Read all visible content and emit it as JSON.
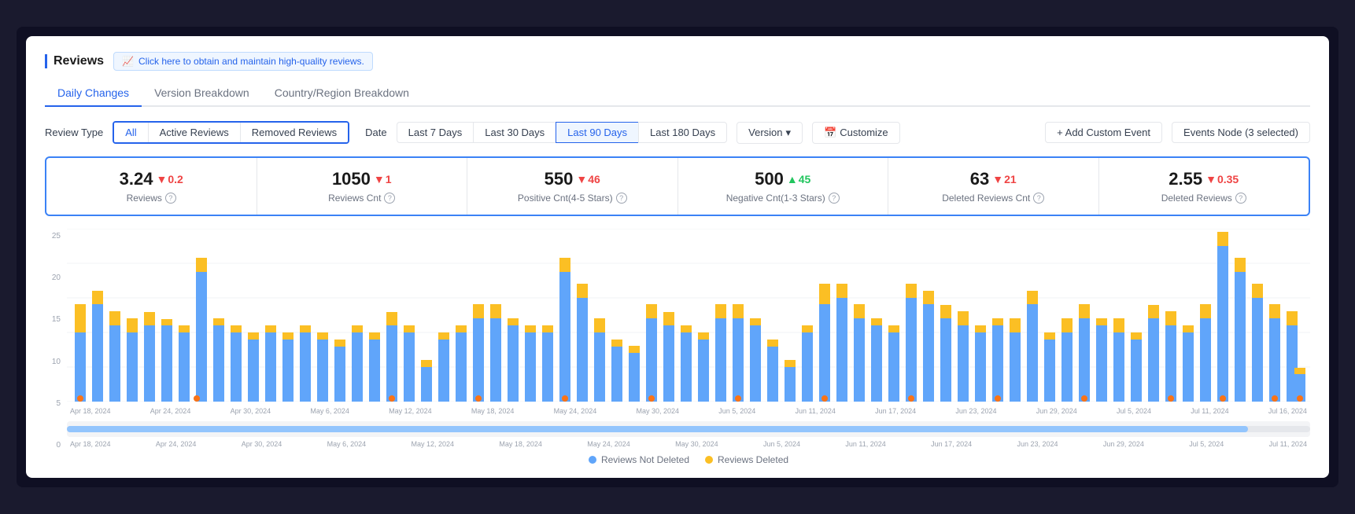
{
  "header": {
    "title": "Reviews",
    "quality_link_text": "Click here to obtain and maintain high-quality reviews.",
    "quality_link_icon": "📈"
  },
  "tabs": [
    {
      "id": "daily-changes",
      "label": "Daily Changes",
      "active": true
    },
    {
      "id": "version-breakdown",
      "label": "Version Breakdown",
      "active": false
    },
    {
      "id": "country-breakdown",
      "label": "Country/Region Breakdown",
      "active": false
    }
  ],
  "filters": {
    "review_type_label": "Review Type",
    "review_type_options": [
      {
        "id": "all",
        "label": "All",
        "active": true
      },
      {
        "id": "active",
        "label": "Active Reviews",
        "active": false
      },
      {
        "id": "removed",
        "label": "Removed Reviews",
        "active": false
      }
    ],
    "date_label": "Date",
    "date_options": [
      {
        "id": "7days",
        "label": "Last 7 Days",
        "active": false
      },
      {
        "id": "30days",
        "label": "Last 30 Days",
        "active": false
      },
      {
        "id": "90days",
        "label": "Last 90 Days",
        "active": true
      },
      {
        "id": "180days",
        "label": "Last 180 Days",
        "active": false
      }
    ],
    "version_btn": "Version",
    "customize_btn": "Customize",
    "calendar_icon": "📅",
    "add_event_btn": "+ Add Custom Event",
    "events_node_btn": "Events Node (3 selected)"
  },
  "stats": [
    {
      "id": "reviews",
      "value": "3.24",
      "delta": "0.2",
      "delta_dir": "down",
      "label": "Reviews"
    },
    {
      "id": "reviews-cnt",
      "value": "1050",
      "delta": "1",
      "delta_dir": "down",
      "label": "Reviews Cnt"
    },
    {
      "id": "positive-cnt",
      "value": "550",
      "delta": "46",
      "delta_dir": "down",
      "label": "Positive Cnt(4-5 Stars)"
    },
    {
      "id": "negative-cnt",
      "value": "500",
      "delta": "45",
      "delta_dir": "up",
      "label": "Negative Cnt(1-3 Stars)"
    },
    {
      "id": "deleted-cnt",
      "value": "63",
      "delta": "21",
      "delta_dir": "down",
      "label": "Deleted Reviews Cnt"
    },
    {
      "id": "deleted-reviews",
      "value": "2.55",
      "delta": "0.35",
      "delta_dir": "down",
      "label": "Deleted Reviews"
    }
  ],
  "chart": {
    "y_labels": [
      "25",
      "20",
      "15",
      "10",
      "5",
      "0"
    ],
    "x_labels": [
      "Apr 18, 2024",
      "Apr 24, 2024",
      "Apr 30, 2024",
      "May 6, 2024",
      "May 12, 2024",
      "May 18, 2024",
      "May 24, 2024",
      "May 30, 2024",
      "Jun 5, 2024",
      "Jun 11, 2024",
      "Jun 17, 2024",
      "Jun 23, 2024",
      "Jun 29, 2024",
      "Jul 5, 2024",
      "Jul 11, 2024",
      "Jul 16, 2024"
    ],
    "mini_labels": [
      "Apr 18, 2024",
      "Apr 24, 2024",
      "Apr 30, 2024",
      "May 6, 2024",
      "May 12, 2024",
      "May 18, 2024",
      "May 24, 2024",
      "May 30, 2024",
      "Jun 5, 2024",
      "Jun 11, 2024",
      "Jun 17, 2024",
      "Jun 23, 2024",
      "Jun 29, 2024",
      "Jul 5, 2024",
      "Jul 11, 2024"
    ]
  },
  "legend": {
    "item1": "Reviews Not Deleted",
    "item2": "Reviews Deleted"
  }
}
